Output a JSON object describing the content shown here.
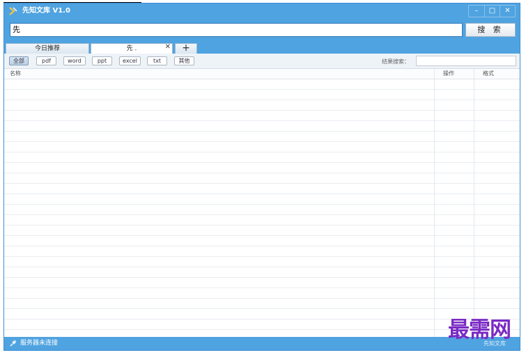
{
  "window": {
    "title": "先知文库 V1.0",
    "controls": {
      "minimize": "–",
      "maximize": "□",
      "close": "✕"
    }
  },
  "search": {
    "query": "先",
    "button_label": "搜 索"
  },
  "tabs": [
    {
      "label": "今日推荐",
      "active": false
    },
    {
      "label": "先 .",
      "active": true,
      "close": "✕"
    }
  ],
  "tab_add": "+",
  "filters": [
    {
      "label": "全部",
      "active": true
    },
    {
      "label": "pdf",
      "active": false
    },
    {
      "label": "word",
      "active": false
    },
    {
      "label": "ppt",
      "active": false
    },
    {
      "label": "excel",
      "active": false
    },
    {
      "label": "txt",
      "active": false
    },
    {
      "label": "其他",
      "active": false
    }
  ],
  "result_search": {
    "label": "结果搜索：",
    "value": ""
  },
  "table": {
    "columns": [
      "名称",
      "操作",
      "格式"
    ],
    "rows": []
  },
  "status": {
    "text": "服务器未连接",
    "brand": "先知文库"
  },
  "watermark": "最需网",
  "colors": {
    "accent": "#4fa3e0",
    "watermark": "#7a2ac4"
  }
}
